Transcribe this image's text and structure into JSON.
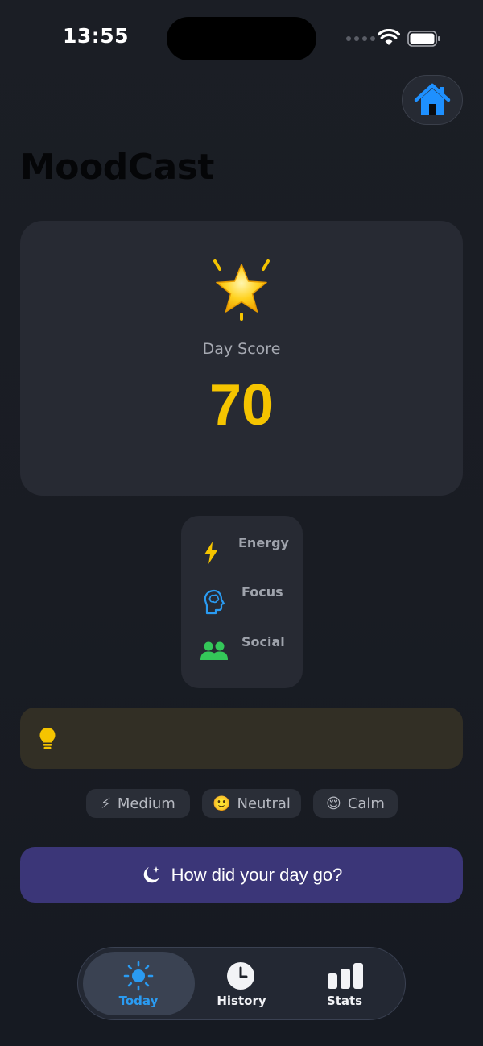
{
  "status_bar": {
    "time": "13:55"
  },
  "app": {
    "title": "MoodCast"
  },
  "score_card": {
    "label": "Day Score",
    "value": "70",
    "icon": "glowing-star-icon",
    "value_color": "#f5c400"
  },
  "metrics": [
    {
      "label": "Energy",
      "icon": "lightning-icon",
      "color": "#f5c400"
    },
    {
      "label": "Focus",
      "icon": "brain-head-icon",
      "color": "#2a9bf2"
    },
    {
      "label": "Social",
      "icon": "people-icon",
      "color": "#34c759"
    }
  ],
  "tip": {
    "icon": "lightbulb-icon",
    "text": ""
  },
  "chips": [
    {
      "emoji": "⚡",
      "label": "Medium"
    },
    {
      "emoji": "🙂",
      "label": "Neutral"
    },
    {
      "emoji": "😌",
      "label": "Calm"
    }
  ],
  "checkin": {
    "label": "How did your day go?",
    "icon": "moon-sparkle-icon"
  },
  "tabs": [
    {
      "label": "Today",
      "icon": "sun-icon",
      "selected": true
    },
    {
      "label": "History",
      "icon": "clock-icon",
      "selected": false
    },
    {
      "label": "Stats",
      "icon": "bar-chart-icon",
      "selected": false
    }
  ],
  "colors": {
    "accent": "#2a9bf2",
    "cta_background": "#3b3678",
    "tip_background": "#322f25"
  }
}
